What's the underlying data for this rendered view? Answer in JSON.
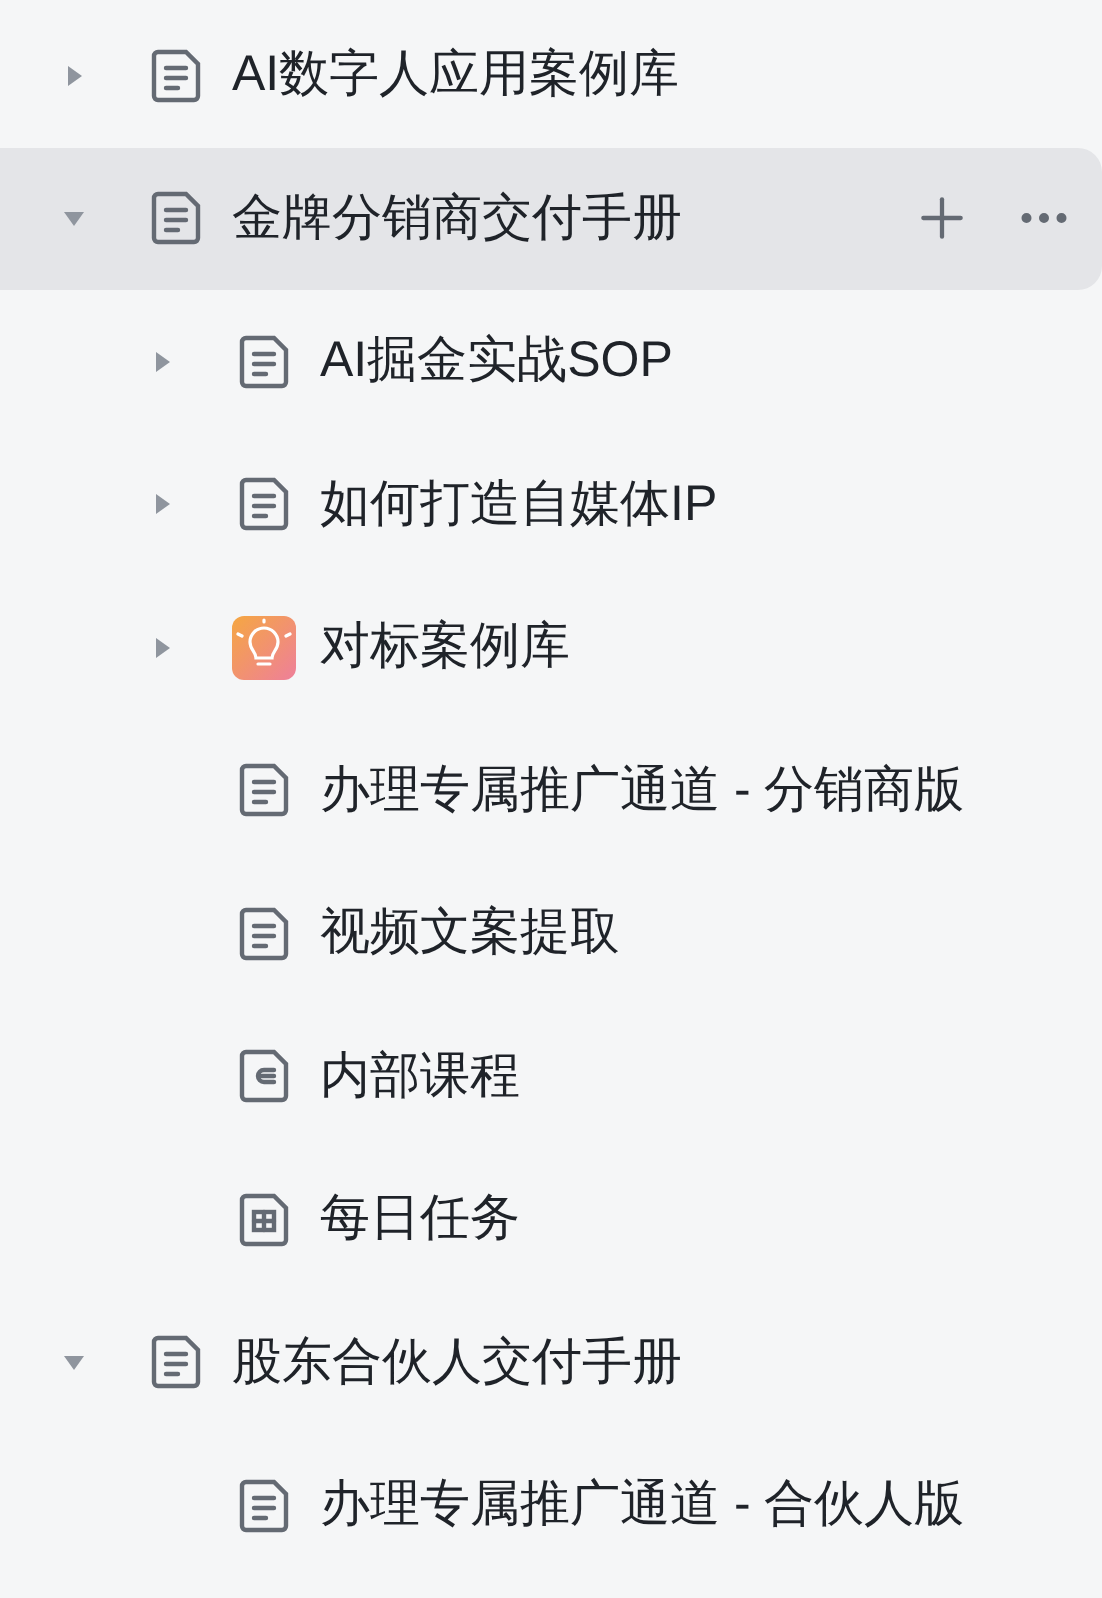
{
  "tree": [
    {
      "title": "AI数字人应用案例库",
      "kind": "doc",
      "expandable": true,
      "expanded": false,
      "selected": false
    },
    {
      "title": "金牌分销商交付手册",
      "kind": "doc",
      "expandable": true,
      "expanded": true,
      "selected": true,
      "children": [
        {
          "title": "AI掘金实战SOP",
          "kind": "doc",
          "expandable": true,
          "expanded": false,
          "selected": false
        },
        {
          "title": "如何打造自媒体IP",
          "kind": "doc",
          "expandable": true,
          "expanded": false,
          "selected": false
        },
        {
          "title": "对标案例库",
          "kind": "idea",
          "expandable": true,
          "expanded": false,
          "selected": false
        },
        {
          "title": "办理专属推广通道 - 分销商版",
          "kind": "doc",
          "expandable": false,
          "selected": false
        },
        {
          "title": "视频文案提取",
          "kind": "doc",
          "expandable": false,
          "selected": false
        },
        {
          "title": "内部课程",
          "kind": "course",
          "expandable": false,
          "selected": false
        },
        {
          "title": "每日任务",
          "kind": "table",
          "expandable": false,
          "selected": false
        }
      ]
    },
    {
      "title": "股东合伙人交付手册",
      "kind": "doc",
      "expandable": true,
      "expanded": true,
      "selected": false,
      "children": [
        {
          "title": "办理专属推广通道 - 合伙人版",
          "kind": "doc",
          "expandable": false,
          "selected": false
        }
      ]
    }
  ]
}
